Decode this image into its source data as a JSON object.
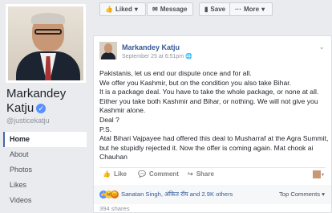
{
  "page": {
    "name_line1": "Markandey",
    "name_line2": "Katju",
    "handle": "@justicekatju"
  },
  "nav": {
    "items": [
      "Home",
      "About",
      "Photos",
      "Likes",
      "Videos"
    ]
  },
  "actionbar": {
    "liked": "Liked",
    "message": "Message",
    "save": "Save",
    "more": "More"
  },
  "post": {
    "author": "Markandey Katju",
    "timestamp": "September 25 at 6:51pm",
    "lines": [
      "Pakistanis, let us end our dispute once and for all.",
      "We offer you Kashmir, but on the condition you also take Bihar.",
      "It is a package deal. You have to take the whole package, or none at all.",
      "Either you take both Kashmir and Bihar, or nothing. We will not give you",
      "Kashmir alone.",
      "Deal ?",
      "P.S.",
      "Atal Bihari Vajpayee had offered this deal to Musharraf at the Agra Summit,",
      "but he stupidly rejected it. Now the offer is coming again. Mat chook ai",
      "Chauhan"
    ],
    "actions": {
      "like": "Like",
      "comment": "Comment",
      "share": "Share"
    },
    "reactions_names": "Sanatan Singh, अंकित रॉय and 2.9K others",
    "top_comments": "Top Comments",
    "shares": "394 shares"
  }
}
